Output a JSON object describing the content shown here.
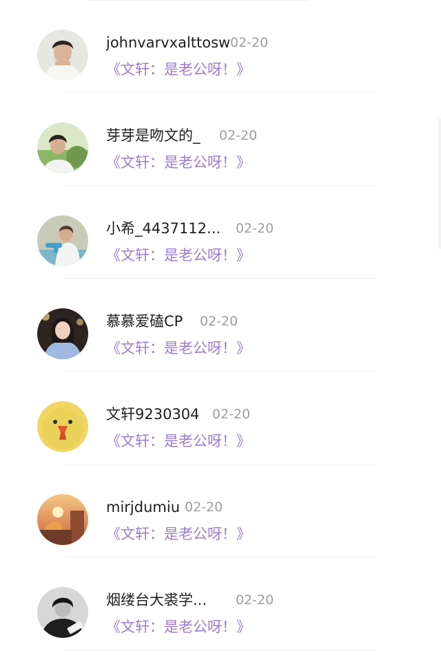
{
  "comments": [
    {
      "username": "johnvarvxalttosw",
      "date": "02-20",
      "text": "《文轩：是老公呀！》",
      "avatar_icon": "boy-portrait-avatar"
    },
    {
      "username": "芽芽是吻文的_",
      "date": "02-20",
      "text": "《文轩：是老公呀！》",
      "avatar_icon": "boy-outdoor-avatar"
    },
    {
      "username": "小希_4437112...",
      "date": "02-20",
      "text": "《文轩：是老公呀！》",
      "avatar_icon": "boy-water-gun-avatar"
    },
    {
      "username": "慕慕爱磕CP",
      "date": "02-20",
      "text": "《文轩：是老公呀！》",
      "avatar_icon": "girl-portrait-avatar"
    },
    {
      "username": "文轩9230304",
      "date": "02-20",
      "text": "《文轩：是老公呀！》",
      "avatar_icon": "yellow-duck-avatar"
    },
    {
      "username": "mirjdumiu",
      "date": "02-20",
      "text": "《文轩：是老公呀！》",
      "avatar_icon": "sunset-building-avatar"
    },
    {
      "username": "烟缕台大裘学...",
      "date": "02-20",
      "text": "《文轩：是老公呀！》",
      "avatar_icon": "monochrome-portrait-avatar"
    }
  ],
  "colors": {
    "comment_text": "#9d7ccc",
    "date_text": "#9d9d9d",
    "username_text": "#1f1f1f"
  }
}
